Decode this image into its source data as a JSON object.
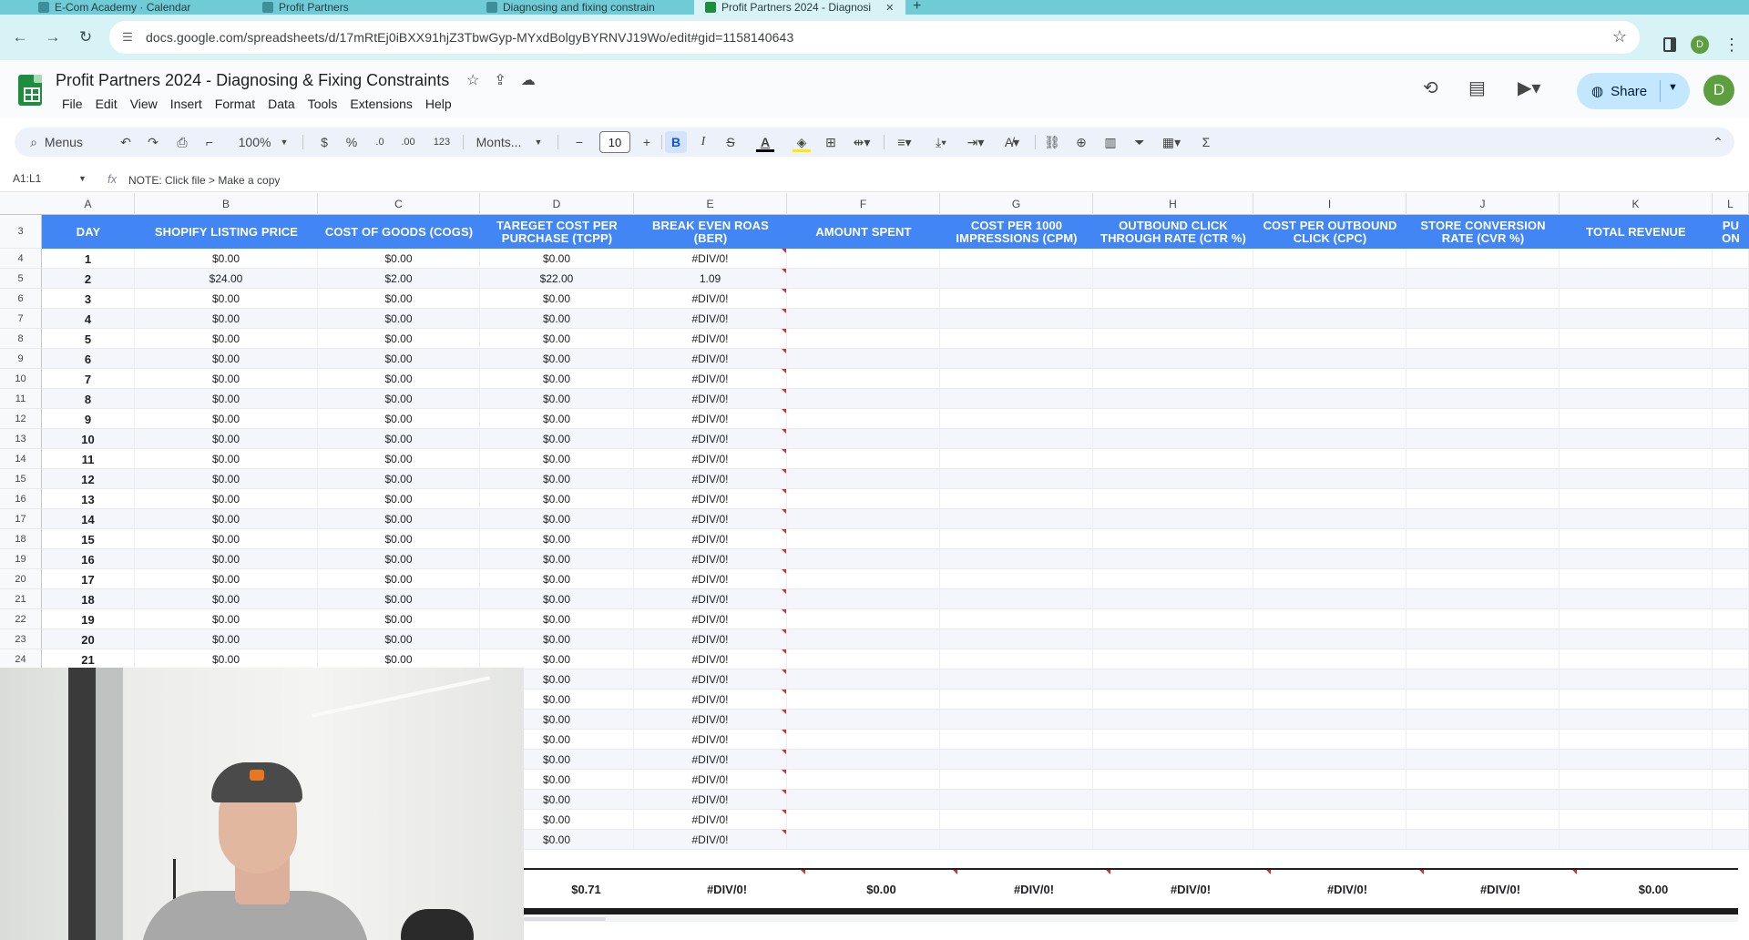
{
  "browser": {
    "tabs": [
      {
        "label": "E-Com Academy · Calendar"
      },
      {
        "label": "Profit Partners"
      },
      {
        "label": "Diagnosing and fixing constrain"
      },
      {
        "label": "Profit Partners 2024 - Diagnosi"
      }
    ],
    "url": "docs.google.com/spreadsheets/d/17mRtEj0iBXX91hjZ3TbwGyp-MYxdBolgyBYRNVJ19Wo/edit#gid=1158140643",
    "profile_initial": "D"
  },
  "sheet": {
    "title": "Profit Partners 2024 - Diagnosing & Fixing Constraints",
    "menu": [
      "File",
      "Edit",
      "View",
      "Insert",
      "Format",
      "Data",
      "Tools",
      "Extensions",
      "Help"
    ],
    "share_label": "Share",
    "avatar_initial": "D"
  },
  "toolbar": {
    "menus_label": "Menus",
    "zoom": "100%",
    "currency": "$",
    "percent": "%",
    "dec_decrease": ".0",
    "dec_increase": ".00",
    "number_format": "123",
    "font": "Monts...",
    "font_size": "10",
    "bold": "B",
    "italic": "I",
    "text_color": "A",
    "sum": "Σ"
  },
  "formula_bar": {
    "name_box": "A1:L1",
    "fx": "fx",
    "content": "NOTE: Click file > Make a copy"
  },
  "columns": [
    "A",
    "B",
    "C",
    "D",
    "E",
    "F",
    "G",
    "H",
    "I",
    "J",
    "K",
    "L"
  ],
  "header_row": {
    "row_number": "3",
    "cells": [
      "DAY",
      "SHOPIFY LISTING PRICE",
      "COST OF GOODS (COGS)",
      "TAREGET COST PER PURCHASE (TCPP)",
      "BREAK EVEN ROAS (BER)",
      "AMOUNT SPENT",
      "COST PER 1000 IMPRESSIONS (CPM)",
      "OUTBOUND CLICK THROUGH RATE (CTR %)",
      "COST PER OUTBOUND CLICK (CPC)",
      "STORE CONVERSION RATE (CVR %)",
      "TOTAL REVENUE",
      "PU ON"
    ]
  },
  "rows": [
    {
      "n": "4",
      "day": "1",
      "price": "$0.00",
      "cogs": "$0.00",
      "tcpp": "$0.00",
      "ber": "#DIV/0!"
    },
    {
      "n": "5",
      "day": "2",
      "price": "$24.00",
      "cogs": "$2.00",
      "tcpp": "$22.00",
      "ber": "1.09"
    },
    {
      "n": "6",
      "day": "3",
      "price": "$0.00",
      "cogs": "$0.00",
      "tcpp": "$0.00",
      "ber": "#DIV/0!"
    },
    {
      "n": "7",
      "day": "4",
      "price": "$0.00",
      "cogs": "$0.00",
      "tcpp": "$0.00",
      "ber": "#DIV/0!"
    },
    {
      "n": "8",
      "day": "5",
      "price": "$0.00",
      "cogs": "$0.00",
      "tcpp": "$0.00",
      "ber": "#DIV/0!"
    },
    {
      "n": "9",
      "day": "6",
      "price": "$0.00",
      "cogs": "$0.00",
      "tcpp": "$0.00",
      "ber": "#DIV/0!"
    },
    {
      "n": "10",
      "day": "7",
      "price": "$0.00",
      "cogs": "$0.00",
      "tcpp": "$0.00",
      "ber": "#DIV/0!"
    },
    {
      "n": "11",
      "day": "8",
      "price": "$0.00",
      "cogs": "$0.00",
      "tcpp": "$0.00",
      "ber": "#DIV/0!"
    },
    {
      "n": "12",
      "day": "9",
      "price": "$0.00",
      "cogs": "$0.00",
      "tcpp": "$0.00",
      "ber": "#DIV/0!"
    },
    {
      "n": "13",
      "day": "10",
      "price": "$0.00",
      "cogs": "$0.00",
      "tcpp": "$0.00",
      "ber": "#DIV/0!"
    },
    {
      "n": "14",
      "day": "11",
      "price": "$0.00",
      "cogs": "$0.00",
      "tcpp": "$0.00",
      "ber": "#DIV/0!"
    },
    {
      "n": "15",
      "day": "12",
      "price": "$0.00",
      "cogs": "$0.00",
      "tcpp": "$0.00",
      "ber": "#DIV/0!"
    },
    {
      "n": "16",
      "day": "13",
      "price": "$0.00",
      "cogs": "$0.00",
      "tcpp": "$0.00",
      "ber": "#DIV/0!"
    },
    {
      "n": "17",
      "day": "14",
      "price": "$0.00",
      "cogs": "$0.00",
      "tcpp": "$0.00",
      "ber": "#DIV/0!"
    },
    {
      "n": "18",
      "day": "15",
      "price": "$0.00",
      "cogs": "$0.00",
      "tcpp": "$0.00",
      "ber": "#DIV/0!"
    },
    {
      "n": "19",
      "day": "16",
      "price": "$0.00",
      "cogs": "$0.00",
      "tcpp": "$0.00",
      "ber": "#DIV/0!"
    },
    {
      "n": "20",
      "day": "17",
      "price": "$0.00",
      "cogs": "$0.00",
      "tcpp": "$0.00",
      "ber": "#DIV/0!"
    },
    {
      "n": "21",
      "day": "18",
      "price": "$0.00",
      "cogs": "$0.00",
      "tcpp": "$0.00",
      "ber": "#DIV/0!"
    },
    {
      "n": "22",
      "day": "19",
      "price": "$0.00",
      "cogs": "$0.00",
      "tcpp": "$0.00",
      "ber": "#DIV/0!"
    },
    {
      "n": "23",
      "day": "20",
      "price": "$0.00",
      "cogs": "$0.00",
      "tcpp": "$0.00",
      "ber": "#DIV/0!"
    },
    {
      "n": "24",
      "day": "21",
      "price": "$0.00",
      "cogs": "$0.00",
      "tcpp": "$0.00",
      "ber": "#DIV/0!"
    },
    {
      "n": "",
      "day": "",
      "price": "",
      "cogs": "",
      "tcpp": "$0.00",
      "ber": "#DIV/0!"
    },
    {
      "n": "",
      "day": "",
      "price": "",
      "cogs": "",
      "tcpp": "$0.00",
      "ber": "#DIV/0!"
    },
    {
      "n": "",
      "day": "",
      "price": "",
      "cogs": "",
      "tcpp": "$0.00",
      "ber": "#DIV/0!"
    },
    {
      "n": "",
      "day": "",
      "price": "",
      "cogs": "",
      "tcpp": "$0.00",
      "ber": "#DIV/0!"
    },
    {
      "n": "",
      "day": "",
      "price": "",
      "cogs": "",
      "tcpp": "$0.00",
      "ber": "#DIV/0!"
    },
    {
      "n": "",
      "day": "",
      "price": "",
      "cogs": "",
      "tcpp": "$0.00",
      "ber": "#DIV/0!"
    },
    {
      "n": "",
      "day": "",
      "price": "",
      "cogs": "",
      "tcpp": "$0.00",
      "ber": "#DIV/0!"
    },
    {
      "n": "",
      "day": "",
      "price": "",
      "cogs": "",
      "tcpp": "$0.00",
      "ber": "#DIV/0!"
    },
    {
      "n": "",
      "day": "",
      "price": "",
      "cogs": "",
      "tcpp": "$0.00",
      "ber": "#DIV/0!"
    }
  ],
  "totals": {
    "tcpp": "$0.71",
    "ber": "#DIV/0!",
    "amount_spent": "$0.00",
    "cpm": "#DIV/0!",
    "ctr": "#DIV/0!",
    "cpc": "#DIV/0!",
    "cvr": "#DIV/0!",
    "revenue": "$0.00"
  },
  "colors": {
    "header_blue": "#4285f4",
    "error_marker": "#d93025"
  }
}
